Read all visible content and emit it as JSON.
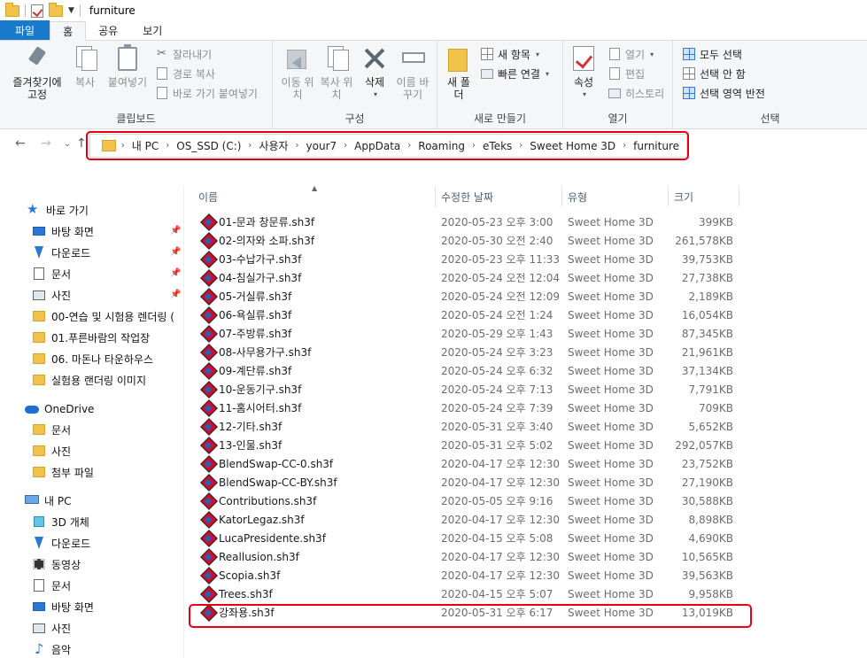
{
  "window": {
    "title": "furniture"
  },
  "tabs": [
    {
      "label": "파일"
    },
    {
      "label": "홈"
    },
    {
      "label": "공유"
    },
    {
      "label": "보기"
    }
  ],
  "ribbon": {
    "clipboard": {
      "label": "클립보드",
      "pin": "즐겨찾기에 고정",
      "copy": "복사",
      "paste": "붙여넣기",
      "cut": "잘라내기",
      "copy_path": "경로 복사",
      "paste_shortcut": "바로 가기 붙여넣기"
    },
    "organize": {
      "label": "구성",
      "move": "이동 위치",
      "copy_to": "복사 위치",
      "delete": "삭제",
      "rename": "이름 바꾸기"
    },
    "new": {
      "label": "새로 만들기",
      "new_folder": "새 폴더",
      "new_item": "새 항목",
      "easy_access": "빠른 연결"
    },
    "open": {
      "label": "열기",
      "properties": "속성",
      "open": "열기",
      "edit": "편집",
      "history": "히스토리"
    },
    "select": {
      "label": "선택",
      "select_all": "모두 선택",
      "select_none": "선택 안 함",
      "invert": "선택 영역 반전"
    }
  },
  "address": {
    "crumbs": [
      "내 PC",
      "OS_SSD (C:)",
      "사용자",
      "your7",
      "AppData",
      "Roaming",
      "eTeks",
      "Sweet Home 3D",
      "furniture"
    ]
  },
  "nav": {
    "quick_access": "바로 가기",
    "items": [
      {
        "label": "바탕 화면",
        "icon": "desktop-icon"
      },
      {
        "label": "다운로드",
        "icon": "download-icon"
      },
      {
        "label": "문서",
        "icon": "document-icon"
      },
      {
        "label": "사진",
        "icon": "picture-icon"
      },
      {
        "label": "00-연습 및 시험용 렌더링 (",
        "icon": "folder-icon"
      },
      {
        "label": "01.푸른바람의 작업장",
        "icon": "folder-icon"
      },
      {
        "label": "06. 마돈나 타운하우스",
        "icon": "folder-icon"
      },
      {
        "label": "실험용 랜더링 이미지",
        "icon": "folder-icon"
      }
    ],
    "onedrive": "OneDrive",
    "onedrive_items": [
      {
        "label": "문서"
      },
      {
        "label": "사진"
      },
      {
        "label": "첨부 파일"
      }
    ],
    "this_pc": "내 PC",
    "pc_items": [
      {
        "label": "3D 개체",
        "icon": "3d-objects-icon"
      },
      {
        "label": "다운로드",
        "icon": "download-icon"
      },
      {
        "label": "동영상",
        "icon": "video-icon"
      },
      {
        "label": "문서",
        "icon": "document-icon"
      },
      {
        "label": "바탕 화면",
        "icon": "desktop-icon"
      },
      {
        "label": "사진",
        "icon": "picture-icon"
      },
      {
        "label": "음악",
        "icon": "music-icon"
      }
    ]
  },
  "columns": {
    "name": "이름",
    "date": "수정한 날짜",
    "type": "유형",
    "size": "크기"
  },
  "files": [
    {
      "name": "01-문과 창문류.sh3f",
      "date": "2020-05-23 오후 3:00",
      "type": "Sweet Home 3D",
      "size": "399KB"
    },
    {
      "name": "02-의자와 소파.sh3f",
      "date": "2020-05-30 오전 2:40",
      "type": "Sweet Home 3D",
      "size": "261,578KB"
    },
    {
      "name": "03-수납가구.sh3f",
      "date": "2020-05-23 오후 11:33",
      "type": "Sweet Home 3D",
      "size": "39,753KB"
    },
    {
      "name": "04-침실가구.sh3f",
      "date": "2020-05-24 오전 12:04",
      "type": "Sweet Home 3D",
      "size": "27,738KB"
    },
    {
      "name": "05-거실류.sh3f",
      "date": "2020-05-24 오전 12:09",
      "type": "Sweet Home 3D",
      "size": "2,189KB"
    },
    {
      "name": "06-욕실류.sh3f",
      "date": "2020-05-24 오전 1:24",
      "type": "Sweet Home 3D",
      "size": "16,054KB"
    },
    {
      "name": "07-주방류.sh3f",
      "date": "2020-05-29 오후 1:43",
      "type": "Sweet Home 3D",
      "size": "87,345KB"
    },
    {
      "name": "08-사무용가구.sh3f",
      "date": "2020-05-24 오후 3:23",
      "type": "Sweet Home 3D",
      "size": "21,961KB"
    },
    {
      "name": "09-계단류.sh3f",
      "date": "2020-05-24 오후 6:32",
      "type": "Sweet Home 3D",
      "size": "37,134KB"
    },
    {
      "name": "10-운동기구.sh3f",
      "date": "2020-05-24 오후 7:13",
      "type": "Sweet Home 3D",
      "size": "7,791KB"
    },
    {
      "name": "11-홈시어터.sh3f",
      "date": "2020-05-24 오후 7:39",
      "type": "Sweet Home 3D",
      "size": "709KB"
    },
    {
      "name": "12-기타.sh3f",
      "date": "2020-05-31 오후 3:40",
      "type": "Sweet Home 3D",
      "size": "5,652KB"
    },
    {
      "name": "13-인물.sh3f",
      "date": "2020-05-31 오후 5:02",
      "type": "Sweet Home 3D",
      "size": "292,057KB"
    },
    {
      "name": "BlendSwap-CC-0.sh3f",
      "date": "2020-04-17 오후 12:30",
      "type": "Sweet Home 3D",
      "size": "23,752KB"
    },
    {
      "name": "BlendSwap-CC-BY.sh3f",
      "date": "2020-04-17 오후 12:30",
      "type": "Sweet Home 3D",
      "size": "27,190KB"
    },
    {
      "name": "Contributions.sh3f",
      "date": "2020-05-05 오후 9:16",
      "type": "Sweet Home 3D",
      "size": "30,588KB"
    },
    {
      "name": "KatorLegaz.sh3f",
      "date": "2020-04-17 오후 12:30",
      "type": "Sweet Home 3D",
      "size": "8,898KB"
    },
    {
      "name": "LucaPresidente.sh3f",
      "date": "2020-04-15 오후 5:08",
      "type": "Sweet Home 3D",
      "size": "4,690KB"
    },
    {
      "name": "Reallusion.sh3f",
      "date": "2020-04-17 오후 12:30",
      "type": "Sweet Home 3D",
      "size": "10,565KB"
    },
    {
      "name": "Scopia.sh3f",
      "date": "2020-04-17 오후 12:30",
      "type": "Sweet Home 3D",
      "size": "39,563KB"
    },
    {
      "name": "Trees.sh3f",
      "date": "2020-04-15 오후 5:07",
      "type": "Sweet Home 3D",
      "size": "9,958KB"
    },
    {
      "name": "강좌용.sh3f",
      "date": "2020-05-31 오후 6:17",
      "type": "Sweet Home 3D",
      "size": "13,019KB"
    }
  ]
}
